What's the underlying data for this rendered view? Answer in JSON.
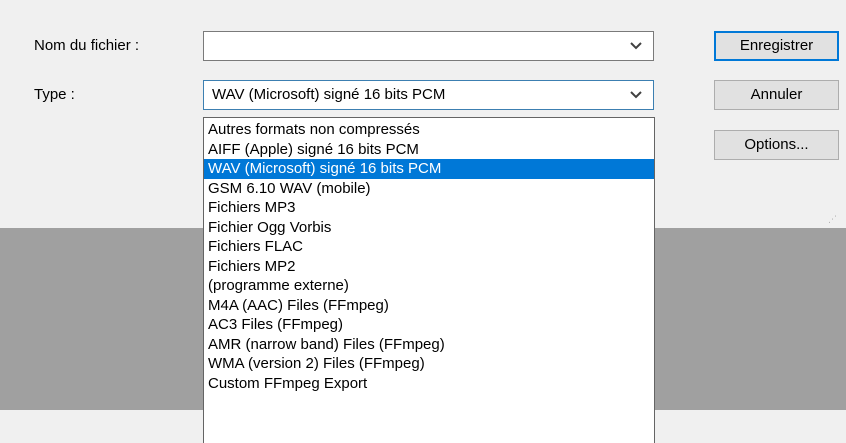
{
  "form": {
    "filename_label": "Nom du fichier :",
    "filename_value": "",
    "type_label": "Type :",
    "type_value": "WAV (Microsoft) signé 16 bits PCM"
  },
  "buttons": {
    "save": "Enregistrer",
    "cancel": "Annuler",
    "options": "Options..."
  },
  "dropdown": {
    "selected_index": 2,
    "options": [
      "Autres formats non compressés",
      "AIFF (Apple) signé 16 bits PCM",
      "WAV (Microsoft) signé 16 bits PCM",
      "GSM 6.10 WAV (mobile)",
      "Fichiers MP3",
      "Fichier Ogg Vorbis",
      "Fichiers FLAC",
      "Fichiers MP2",
      "(programme externe)",
      "M4A (AAC) Files (FFmpeg)",
      "AC3 Files (FFmpeg)",
      "AMR (narrow band) Files (FFmpeg)",
      "WMA (version 2) Files (FFmpeg)",
      "Custom FFmpeg Export"
    ]
  },
  "icons": {
    "chevron": "chevron-down-icon"
  },
  "colors": {
    "highlight": "#0078d7",
    "dialog_bg": "#f0f0f0",
    "backdrop": "#a0a0a0"
  }
}
